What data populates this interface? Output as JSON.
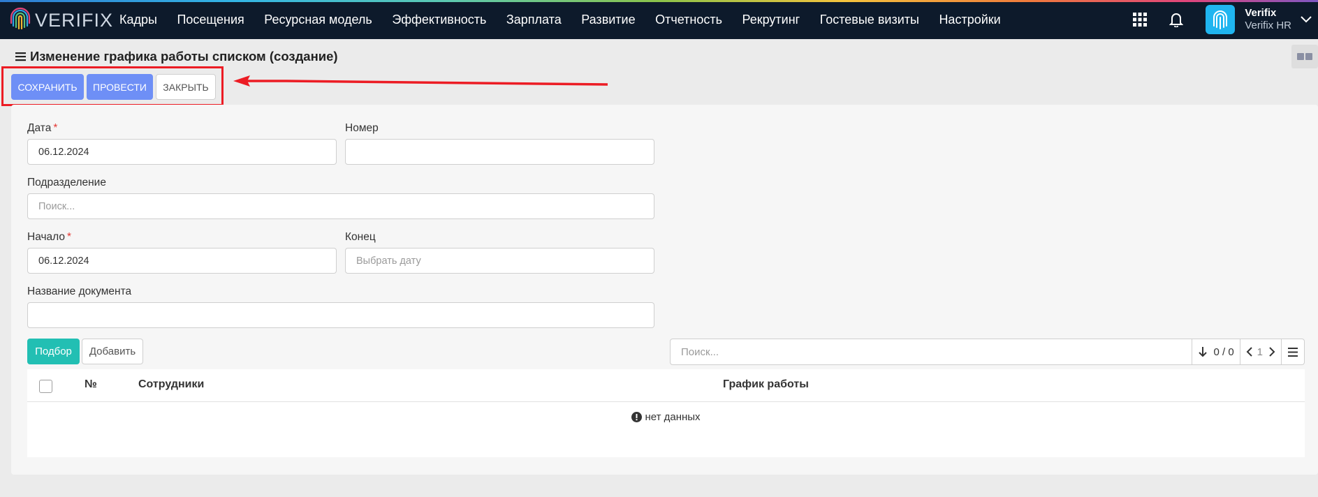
{
  "app": {
    "logo_text": "VERIFIX",
    "nav": [
      "Кадры",
      "Посещения",
      "Ресурсная модель",
      "Эффективность",
      "Зарплата",
      "Развитие",
      "Отчетность",
      "Рекрутинг",
      "Гостевые визиты",
      "Настройки"
    ],
    "user": {
      "name": "Verifix",
      "org": "Verifix HR"
    }
  },
  "page": {
    "title": "Изменение графика работы списком (создание)",
    "toolbar": {
      "save": "СОХРАНИТЬ",
      "post": "ПРОВЕСТИ",
      "close": "ЗАКРЫТЬ"
    },
    "annotation": {
      "color": "#ec1c24"
    }
  },
  "form": {
    "date": {
      "label": "Дата",
      "required_mark": "*",
      "value": "06.12.2024"
    },
    "number": {
      "label": "Номер",
      "value": ""
    },
    "division": {
      "label": "Подразделение",
      "placeholder": "Поиск..."
    },
    "start": {
      "label": "Начало",
      "required_mark": "*",
      "value": "06.12.2024"
    },
    "end": {
      "label": "Конец",
      "placeholder": "Выбрать дату"
    },
    "doc_name": {
      "label": "Название документа",
      "value": ""
    }
  },
  "grid": {
    "select_button": "Подбор",
    "add_button": "Добавить",
    "search_placeholder": "Поиск...",
    "counter": "0 / 0",
    "page": "1",
    "columns": {
      "number": "№",
      "employees": "Сотрудники",
      "schedule": "График работы"
    },
    "empty_text": "нет данных"
  },
  "colors": {
    "primary": "#6e8ff6",
    "teal": "#22bfb3",
    "navbar": "#0d1a2b"
  }
}
